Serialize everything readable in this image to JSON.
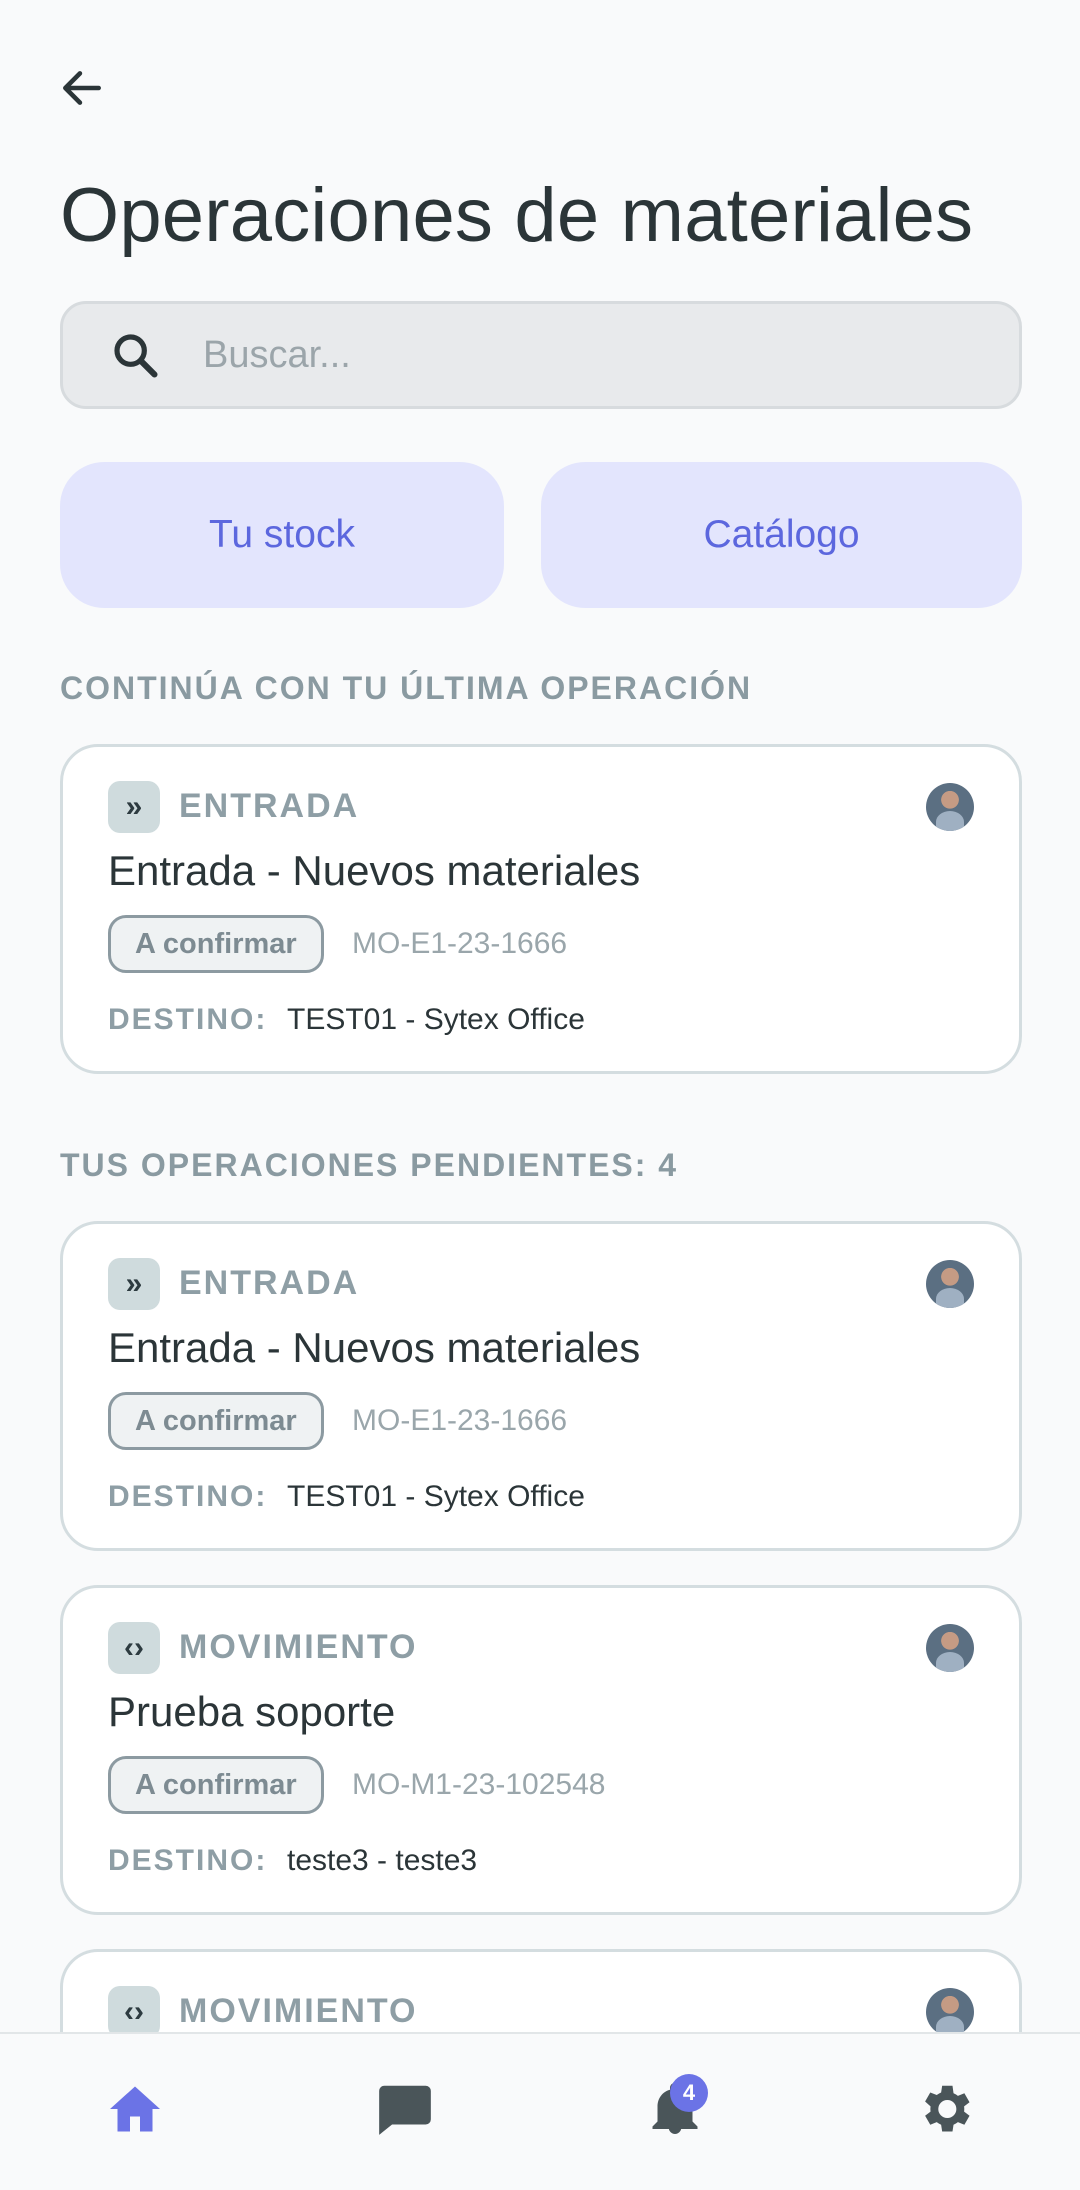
{
  "page": {
    "title": "Operaciones de materiales",
    "back_icon": "arrow-left-icon"
  },
  "search": {
    "placeholder": "Buscar...",
    "icon": "search-icon"
  },
  "quick_actions": {
    "stock_label": "Tu stock",
    "catalog_label": "Catálogo"
  },
  "last_operation": {
    "section_title": "CONTINÚA CON TU ÚLTIMA OPERACIÓN",
    "card": {
      "type_icon": "»",
      "type": "ENTRADA",
      "name": "Entrada - Nuevos materiales",
      "status": "A confirmar",
      "code": "MO-E1-23-1666",
      "dest_label": "DESTINO:",
      "dest_value": "TEST01 - Sytex Office"
    }
  },
  "pending": {
    "section_title": "TUS OPERACIONES PENDIENTES: 4",
    "cards": [
      {
        "type_icon": "»",
        "type": "ENTRADA",
        "name": "Entrada - Nuevos materiales",
        "status": "A confirmar",
        "code": "MO-E1-23-1666",
        "dest_label": "DESTINO:",
        "dest_value": "TEST01 - Sytex Office"
      },
      {
        "type_icon": "‹›",
        "type": "MOVIMIENTO",
        "name": "Prueba soporte",
        "status": "A confirmar",
        "code": "MO-M1-23-102548",
        "dest_label": "DESTINO:",
        "dest_value": "teste3 - teste3"
      },
      {
        "type_icon": "‹›",
        "type": "MOVIMIENTO"
      }
    ]
  },
  "navbar": {
    "items": [
      {
        "icon": "home-icon",
        "active": true
      },
      {
        "icon": "chat-icon",
        "active": false
      },
      {
        "icon": "bell-icon",
        "active": false,
        "badge": "4"
      },
      {
        "icon": "gear-icon",
        "active": false
      }
    ]
  },
  "colors": {
    "accent": "#6b73e6",
    "pill_bg": "#e3e5fd",
    "text_dark": "#2b3538",
    "text_muted": "#8e9ea5"
  }
}
